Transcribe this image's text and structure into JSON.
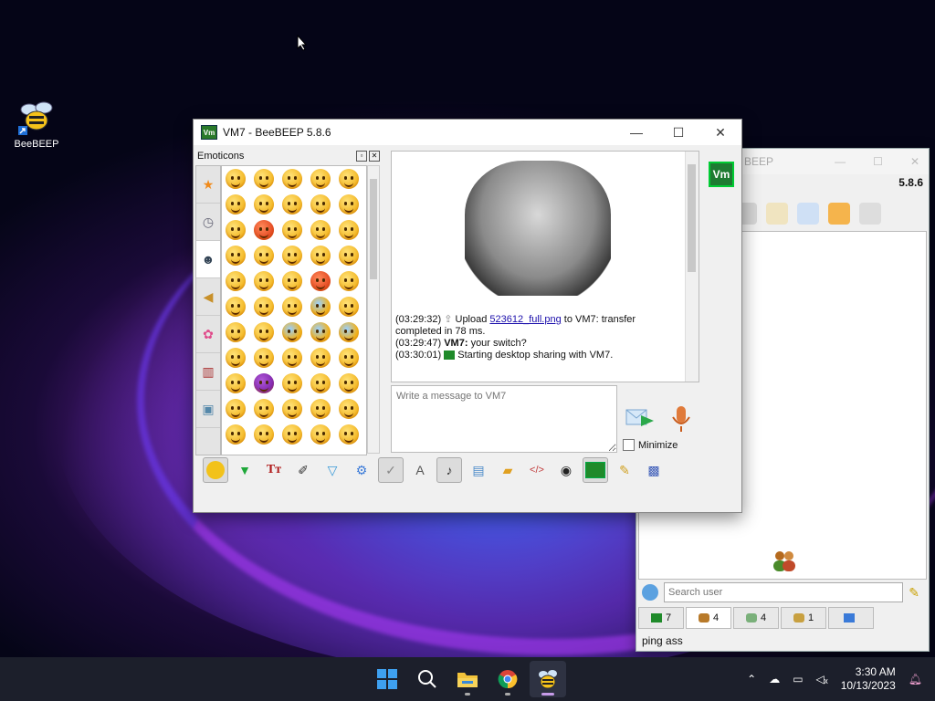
{
  "desktop": {
    "icon_label": "BeeBEEP"
  },
  "main_window": {
    "title": "VM7 - BeeBEEP 5.8.6",
    "vm_label": "Vm",
    "emoticons_label": "Emoticons",
    "chat": {
      "lines": [
        {
          "time": "(03:29:32)",
          "pre": "Upload ",
          "link": "523612_full.png",
          "post": " to VM7: transfer",
          "cont": "completed in 78 ms."
        },
        {
          "time": "(03:29:47)",
          "sender": "VM7:",
          "text": "your switch?"
        },
        {
          "time": "(03:30:01)",
          "text": "Starting desktop sharing with VM7."
        }
      ]
    },
    "message_placeholder": "Write a message to VM7",
    "minimize_label": "Minimize"
  },
  "back_window": {
    "title": "BEEP",
    "version": "5.8.6",
    "search_placeholder": "Search user",
    "tabs": [
      {
        "icon": "monitor-icon",
        "count": "7"
      },
      {
        "icon": "users-icon",
        "count": "4"
      },
      {
        "icon": "chat-icon",
        "count": "4"
      },
      {
        "icon": "group-icon",
        "count": "1"
      },
      {
        "icon": "share-icon",
        "count": ""
      }
    ],
    "status": "ping ass"
  },
  "taskbar": {
    "time": "3:30 AM",
    "date": "10/13/2023"
  }
}
